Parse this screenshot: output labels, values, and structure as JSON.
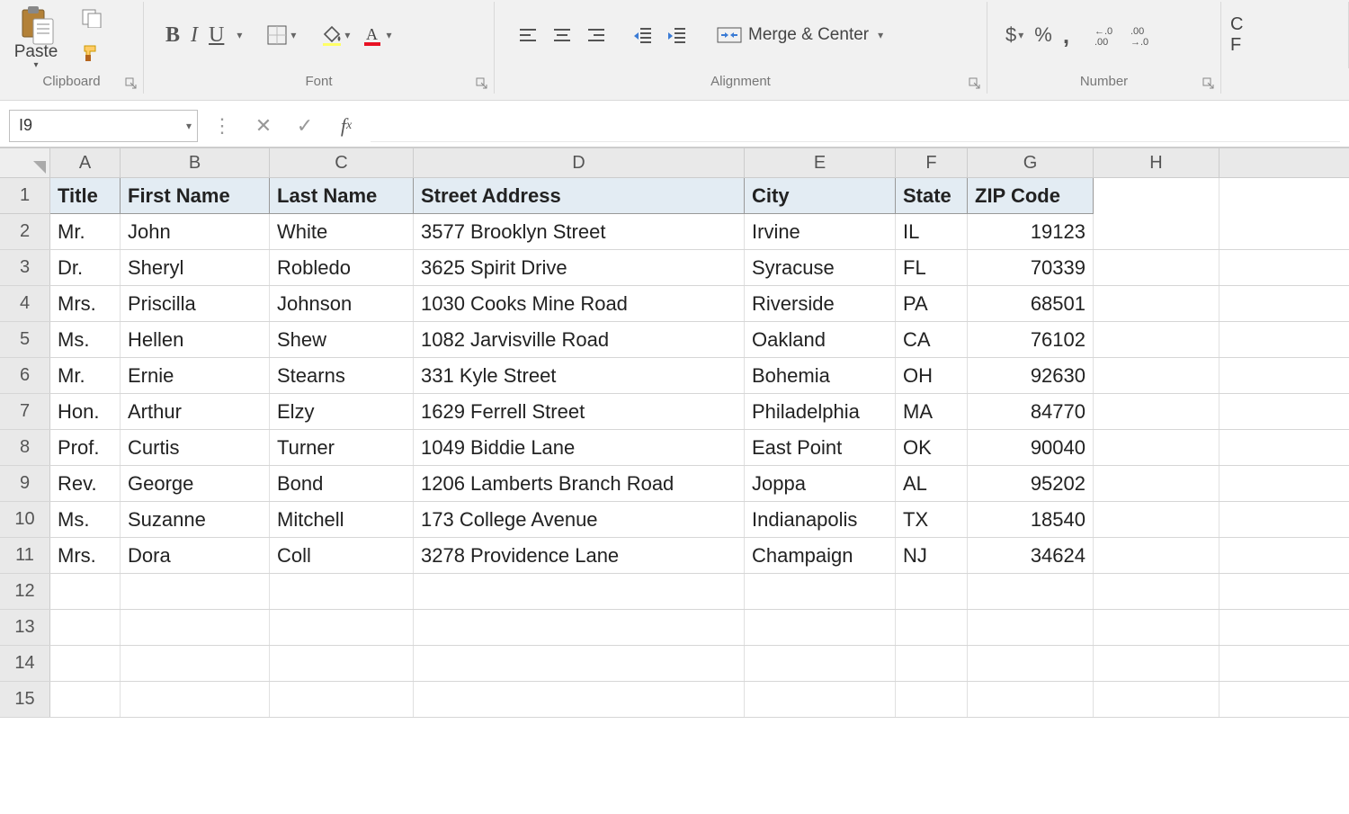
{
  "ribbon": {
    "paste_label": "Paste",
    "merge_label": "Merge & Center",
    "dollar": "$",
    "percent": "%",
    "comma": ",",
    "groups": {
      "clipboard": "Clipboard",
      "font": "Font",
      "alignment": "Alignment",
      "number": "Number"
    }
  },
  "formula_bar": {
    "name_box": "I9",
    "value": ""
  },
  "columns": [
    "A",
    "B",
    "C",
    "D",
    "E",
    "F",
    "G",
    "H"
  ],
  "headers": [
    "Title",
    "First Name",
    "Last Name",
    "Street Address",
    "City",
    "State",
    "ZIP Code"
  ],
  "rows": [
    {
      "n": 1,
      "cells": [
        "Title",
        "First Name",
        "Last Name",
        "Street Address",
        "City",
        "State",
        "ZIP Code"
      ],
      "is_header": true
    },
    {
      "n": 2,
      "cells": [
        "Mr.",
        "John",
        "White",
        "3577 Brooklyn Street",
        "Irvine",
        "IL",
        "19123"
      ]
    },
    {
      "n": 3,
      "cells": [
        "Dr.",
        "Sheryl",
        "Robledo",
        "3625 Spirit Drive",
        "Syracuse",
        "FL",
        "70339"
      ]
    },
    {
      "n": 4,
      "cells": [
        "Mrs.",
        "Priscilla",
        "Johnson",
        "1030 Cooks Mine Road",
        "Riverside",
        "PA",
        "68501"
      ]
    },
    {
      "n": 5,
      "cells": [
        "Ms.",
        "Hellen",
        "Shew",
        "1082 Jarvisville Road",
        "Oakland",
        "CA",
        "76102"
      ]
    },
    {
      "n": 6,
      "cells": [
        "Mr.",
        "Ernie",
        "Stearns",
        "331 Kyle Street",
        "Bohemia",
        "OH",
        "92630"
      ]
    },
    {
      "n": 7,
      "cells": [
        "Hon.",
        "Arthur",
        "Elzy",
        "1629 Ferrell Street",
        "Philadelphia",
        "MA",
        "84770"
      ]
    },
    {
      "n": 8,
      "cells": [
        "Prof.",
        "Curtis",
        "Turner",
        "1049 Biddie Lane",
        "East Point",
        "OK",
        "90040"
      ]
    },
    {
      "n": 9,
      "cells": [
        "Rev.",
        "George",
        "Bond",
        "1206 Lamberts Branch Road",
        "Joppa",
        "AL",
        "95202"
      ]
    },
    {
      "n": 10,
      "cells": [
        "Ms.",
        "Suzanne",
        "Mitchell",
        "173 College Avenue",
        "Indianapolis",
        "TX",
        "18540"
      ]
    },
    {
      "n": 11,
      "cells": [
        "Mrs.",
        "Dora",
        "Coll",
        "3278 Providence Lane",
        "Champaign",
        "NJ",
        "34624"
      ]
    },
    {
      "n": 12,
      "cells": [
        "",
        "",
        "",
        "",
        "",
        "",
        ""
      ]
    },
    {
      "n": 13,
      "cells": [
        "",
        "",
        "",
        "",
        "",
        "",
        ""
      ]
    },
    {
      "n": 14,
      "cells": [
        "",
        "",
        "",
        "",
        "",
        "",
        ""
      ]
    },
    {
      "n": 15,
      "cells": [
        "",
        "",
        "",
        "",
        "",
        "",
        ""
      ]
    }
  ],
  "numeric_col_index": 6,
  "group_widths": {
    "clipboard": 160,
    "font": 390,
    "alignment": 548,
    "number": 260
  }
}
